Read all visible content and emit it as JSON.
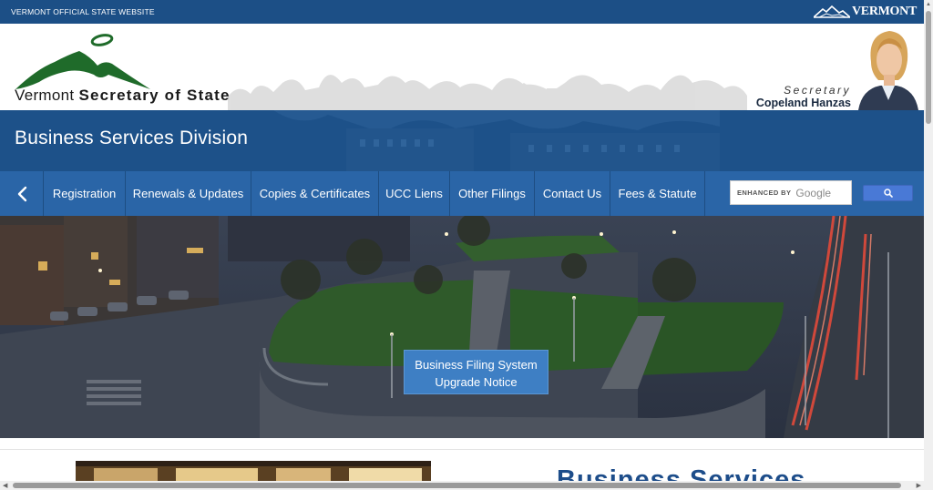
{
  "topbar": {
    "official_label": "VERMONT OFFICIAL STATE WEBSITE",
    "state_logo_text": "VERMONT"
  },
  "header": {
    "title_prefix": "Vermont",
    "title_main": "Secretary of State",
    "secretary_role": "Secretary",
    "secretary_name": "Copeland Hanzas"
  },
  "division": {
    "title": "Business Services Division"
  },
  "nav": {
    "back_icon": "chevron-left-icon",
    "items": [
      {
        "label": "Registration"
      },
      {
        "label": "Renewals & Updates"
      },
      {
        "label": "Copies & Certificates"
      },
      {
        "label": "UCC Liens"
      },
      {
        "label": "Other Filings"
      },
      {
        "label": "Contact Us"
      },
      {
        "label": "Fees & Statute"
      }
    ],
    "search": {
      "enhanced_label": "ENHANCED BY",
      "provider": "Google",
      "button_icon": "search-icon"
    }
  },
  "hero": {
    "notice_button_line1": "Business Filing System",
    "notice_button_line2": "Upgrade Notice"
  },
  "below": {
    "heading": "Business Services"
  },
  "colors": {
    "topbar": "#1c4f86",
    "division": "#1d5189",
    "nav": "#2a65a7",
    "notice_button": "#3e7fc4",
    "heading": "#1d4d8a"
  }
}
